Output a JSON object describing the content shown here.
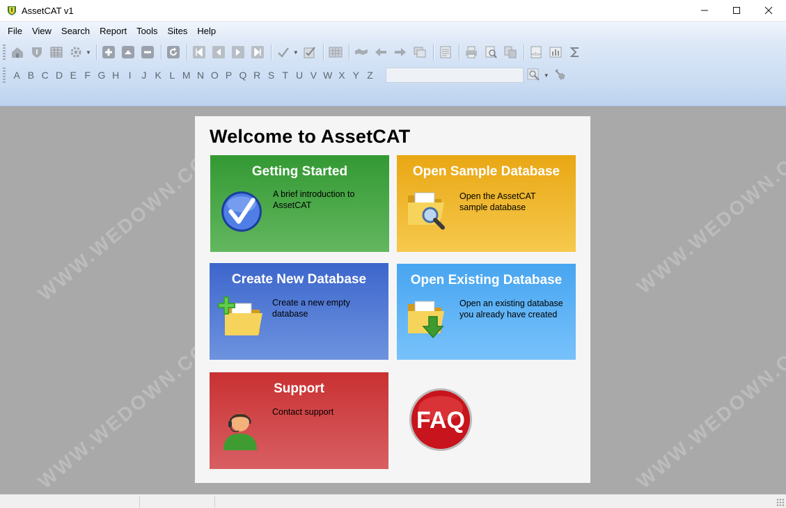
{
  "window": {
    "title": "AssetCAT v1",
    "minimize_glyph": "—",
    "maximize_glyph": "☐",
    "close_glyph": "✕"
  },
  "menu": [
    "File",
    "View",
    "Search",
    "Report",
    "Tools",
    "Sites",
    "Help"
  ],
  "toolbar": {
    "row1_icons": [
      "home-icon",
      "shield-icon",
      "table-icon",
      "settings-icon",
      "add-record-icon",
      "move-up-icon",
      "remove-record-icon",
      "refresh-icon",
      "first-record-icon",
      "previous-record-icon",
      "next-record-icon",
      "last-record-icon",
      "check-icon",
      "checklist-icon",
      "grid-view-icon",
      "handshake-icon",
      "back-arrow-icon",
      "forward-arrow-icon",
      "windows-icon",
      "document-icon",
      "print-icon",
      "print-preview-icon",
      "export-icon",
      "html-report-icon",
      "bar-chart-icon",
      "sum-icon"
    ],
    "alphabet": [
      "A",
      "B",
      "C",
      "D",
      "E",
      "F",
      "G",
      "H",
      "I",
      "J",
      "K",
      "L",
      "M",
      "N",
      "O",
      "P",
      "Q",
      "R",
      "S",
      "T",
      "U",
      "V",
      "W",
      "X",
      "Y",
      "Z"
    ],
    "search_value": "",
    "search_icon": "search-icon",
    "plugin_icon": "plug-icon"
  },
  "welcome": {
    "title": "Welcome to AssetCAT",
    "tiles": [
      {
        "title": "Getting Started",
        "desc": "A brief introduction to AssetCAT",
        "icon": "checkmark-icon",
        "color": "#339933"
      },
      {
        "title": "Open Sample Database",
        "desc": "Open the AssetCAT sample database",
        "icon": "folder-search-icon",
        "color": "#e9a714"
      },
      {
        "title": "Create New Database",
        "desc": "Create a new empty database",
        "icon": "folder-add-icon",
        "color": "#3d66cc"
      },
      {
        "title": "Open Existing Database",
        "desc": "Open an existing database you already have created",
        "icon": "folder-open-icon",
        "color": "#47a5f0"
      },
      {
        "title": "Support",
        "desc": "Contact support",
        "icon": "support-agent-icon",
        "color": "#c93132"
      }
    ],
    "faq_label": "FAQ"
  },
  "watermark": "WWW.WEDOWN.COM"
}
